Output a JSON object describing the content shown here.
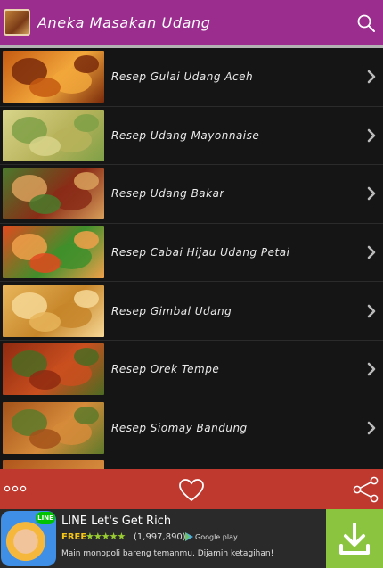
{
  "appbar": {
    "title": "Aneka Masakan Udang",
    "icons": {
      "app": "shrimp-dish-app-icon",
      "search": "search-icon"
    }
  },
  "recipes": [
    {
      "label": "Resep Gulai Udang Aceh",
      "thumb": [
        "#c55a12",
        "#f2a73b",
        "#7a2a0a"
      ]
    },
    {
      "label": "Resep Udang Mayonnaise",
      "thumb": [
        "#d8d48a",
        "#b7b35b",
        "#7fa047"
      ]
    },
    {
      "label": "Resep Udang Bakar",
      "thumb": [
        "#4a7a2c",
        "#8a2c17",
        "#d9a05b"
      ]
    },
    {
      "label": "Resep Cabai Hijau Udang Petai",
      "thumb": [
        "#e04a1e",
        "#3f8f2c",
        "#f0a04a"
      ]
    },
    {
      "label": "Resep Gimbal Udang",
      "thumb": [
        "#e8b55a",
        "#c7862a",
        "#f6d896"
      ]
    },
    {
      "label": "Resep Orek Tempe",
      "thumb": [
        "#8f2a10",
        "#c94f1f",
        "#4b6b22"
      ]
    },
    {
      "label": "Resep Siomay Bandung",
      "thumb": [
        "#a4521a",
        "#d58b3a",
        "#5d7a2a"
      ]
    }
  ],
  "bottombar": {
    "icons": {
      "more": "more-dots-icon",
      "favorite": "heart-icon",
      "share": "share-icon"
    },
    "color": "#c0392f"
  },
  "ad": {
    "title": "LINE Let's Get Rich",
    "badge": "LINE",
    "free_label": "FREE",
    "stars": "★★★★★",
    "reviews": "(1,997,890)",
    "store_label": "Google play",
    "description": "Main monopoli bareng temanmu. Dijamin ketagihan!",
    "icons": {
      "download": "download-icon",
      "store": "google-play-icon"
    }
  },
  "colors": {
    "appbar": "#9a2d8e",
    "list_bg": "#151515",
    "ad_button": "#8bc53f"
  }
}
